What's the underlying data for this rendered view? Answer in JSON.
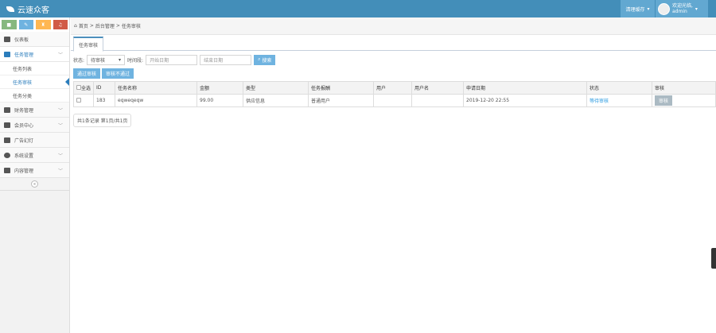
{
  "header": {
    "brand": "云速众客",
    "clear_cache": "清理缓存",
    "welcome": "欢迎光临,",
    "username": "admin"
  },
  "sidebar": {
    "items": [
      {
        "label": "仪表板"
      },
      {
        "label": "任务管理",
        "children": [
          "任务列表",
          "任务审核",
          "任务分类"
        ]
      },
      {
        "label": "财务管理"
      },
      {
        "label": "会员中心"
      },
      {
        "label": "广告幻灯"
      },
      {
        "label": "系统设置"
      },
      {
        "label": "内容管理"
      }
    ],
    "collapse": "«"
  },
  "breadcrumb": [
    "首页",
    "后台管理",
    "任务审核"
  ],
  "tab": "任务审核",
  "filters": {
    "status_label": "状态:",
    "status_value": "待审核",
    "time_label": "时间段:",
    "start_placeholder": "开始日期",
    "end_placeholder": "结束日期",
    "search": "搜索"
  },
  "actions": {
    "approve": "通过审核",
    "reject": "审核不通过"
  },
  "table": {
    "headers": [
      "全选",
      "ID",
      "任务名称",
      "金额",
      "类型",
      "任务报酬",
      "用户",
      "用户名",
      "申请日期",
      "状态",
      "审核"
    ],
    "rows": [
      {
        "id": "183",
        "name": "eqweqeqw",
        "amount": "99.00",
        "type": "供应信息",
        "reward": "普通用户",
        "user": "",
        "username": "",
        "date": "2019-12-20 22:55",
        "status": "等待审核",
        "action": "审核"
      }
    ]
  },
  "pager": "共1条记录 第1页/共1页"
}
